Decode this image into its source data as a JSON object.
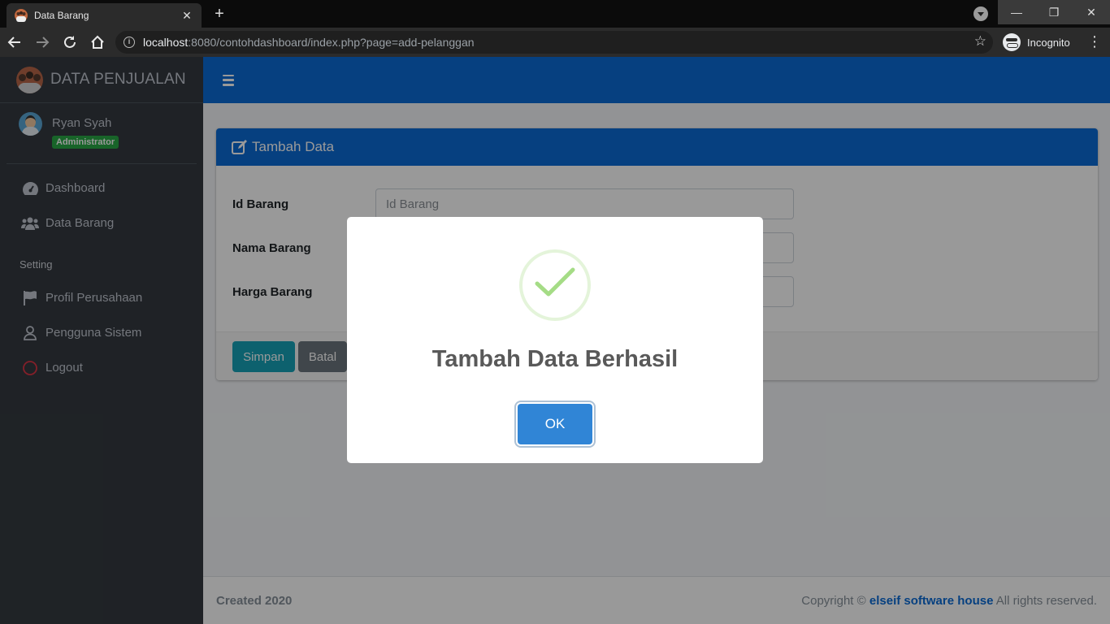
{
  "browser": {
    "tab_title": "Data Barang",
    "url_host": "localhost",
    "url_path": ":8080/contohdashboard/index.php?page=add-pelanggan",
    "incognito_label": "Incognito"
  },
  "sidebar": {
    "brand": "DATA PENJUALAN",
    "user": {
      "name": "Ryan Syah",
      "role": "Administrator"
    },
    "items": [
      {
        "label": "Dashboard",
        "icon": "tachometer-icon"
      },
      {
        "label": "Data Barang",
        "icon": "users-icon"
      }
    ],
    "section_header": "Setting",
    "setting_items": [
      {
        "label": "Profil Perusahaan",
        "icon": "flag-icon"
      },
      {
        "label": "Pengguna Sistem",
        "icon": "user-icon"
      },
      {
        "label": "Logout",
        "icon": "circle-icon"
      }
    ]
  },
  "card": {
    "title": "Tambah Data",
    "fields": [
      {
        "label": "Id Barang",
        "placeholder": "Id Barang"
      },
      {
        "label": "Nama Barang",
        "placeholder": ""
      },
      {
        "label": "Harga Barang",
        "placeholder": ""
      }
    ],
    "save_label": "Simpan",
    "cancel_label": "Batal"
  },
  "footer": {
    "left": "Created 2020",
    "copyright_prefix": "Copyright ©",
    "company": "elseif software house",
    "suffix": "All rights reserved."
  },
  "modal": {
    "title": "Tambah Data Berhasil",
    "ok_label": "OK"
  },
  "colors": {
    "primary": "#0b6bd6",
    "sidebar": "#343a40",
    "success_badge": "#28a745",
    "save_button": "#17a2b8",
    "cancel_button": "#6c757d",
    "ok_button": "#3085d6",
    "checkmark": "#a5dc86"
  }
}
